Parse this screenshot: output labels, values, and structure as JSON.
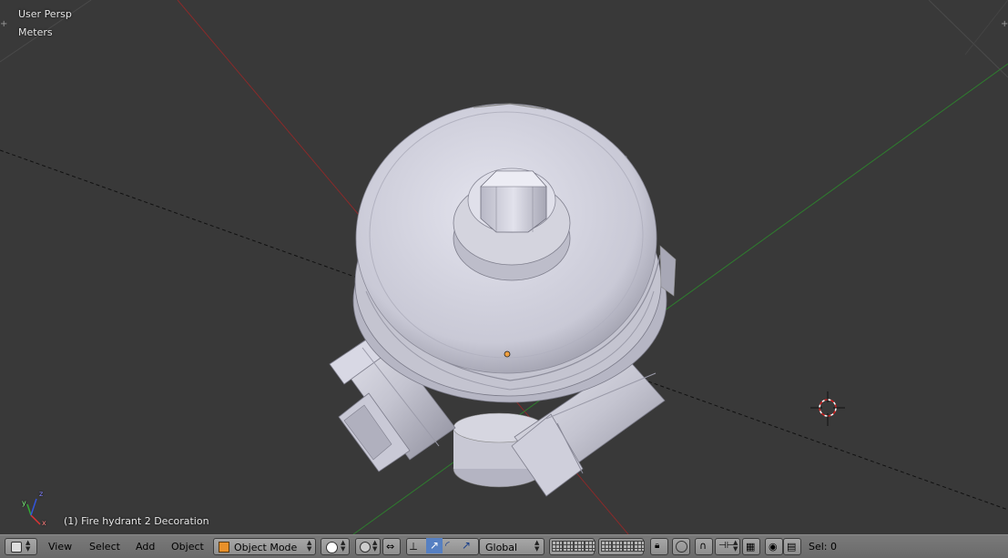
{
  "viewport": {
    "view_name": "User Persp",
    "units": "Meters",
    "object_info": "(1) Fire hydrant 2 Decoration",
    "axis_labels": {
      "x": "x",
      "y": "y",
      "z": "z"
    }
  },
  "header": {
    "menus": [
      "View",
      "Select",
      "Add",
      "Object"
    ],
    "mode": "Object Mode",
    "orientation": "Global",
    "selection_status": "Sel: 0"
  },
  "colors": {
    "background": "#393939",
    "x_axis": "#8a2a2a",
    "y_axis": "#2e7d2e",
    "header": "#727272",
    "active_button": "#5680c2"
  },
  "icons": [
    "editor-type-icon",
    "object-mode-cube-icon",
    "viewport-shading-icon",
    "pivot-icon",
    "snap-icon",
    "manipulator-icon",
    "translate-icon",
    "rotate-icon",
    "scale-icon",
    "layers-icon",
    "lock-icon",
    "proportional-edit-icon",
    "snap-magnet-icon",
    "snap-element-icon",
    "render-icon",
    "animation-icon",
    "3d-cursor-icon"
  ]
}
